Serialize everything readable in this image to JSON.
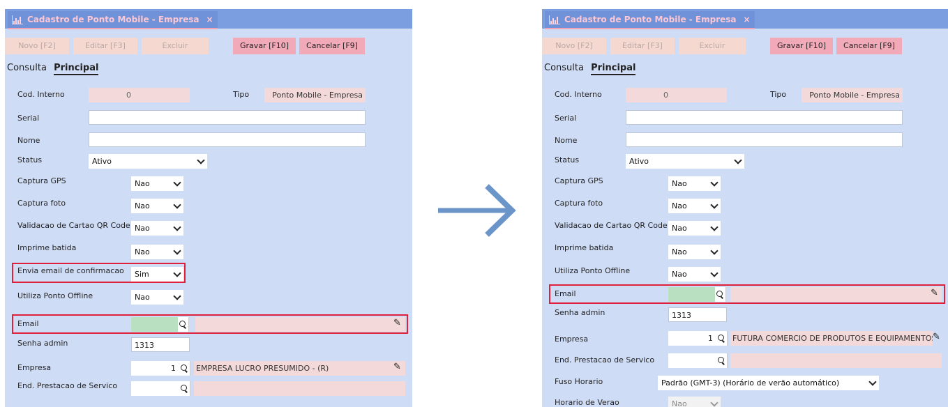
{
  "window": {
    "title": "Cadastro de Ponto Mobile - Empresa",
    "close": "×"
  },
  "toolbar": {
    "novo": "Novo [F2]",
    "editar": "Editar [F3]",
    "excluir": "Excluir",
    "gravar": "Gravar [F10]",
    "cancelar": "Cancelar [F9]"
  },
  "tabs": {
    "consulta": "Consulta",
    "principal": "Principal"
  },
  "labels": {
    "cod_interno": "Cod. Interno",
    "tipo": "Tipo",
    "serial": "Serial",
    "nome": "Nome",
    "status": "Status",
    "captura_gps": "Captura GPS",
    "captura_foto": "Captura foto",
    "validacao_qr": "Validacao de Cartao QR Code",
    "imprime_batida": "Imprime batida",
    "envia_email": "Envia email de confirmacao",
    "utiliza_offline": "Utiliza Ponto Offline",
    "email": "Email",
    "senha_admin": "Senha admin",
    "empresa": "Empresa",
    "end_prestacao": "End. Prestacao de Servico",
    "fuso_horario": "Fuso Horario",
    "horario_verao": "Horario de Verao"
  },
  "before": {
    "cod_interno": "0",
    "tipo": "Ponto Mobile - Empresa",
    "status": "Ativo",
    "captura_gps": "Nao",
    "captura_foto": "Nao",
    "validacao_qr": "Nao",
    "imprime_batida": "Nao",
    "envia_email": "Sim",
    "utiliza_offline": "Nao",
    "senha_admin": "1313",
    "empresa_code": "1",
    "empresa_name": "EMPRESA LUCRO PRESUMIDO - (R)"
  },
  "after": {
    "cod_interno": "0",
    "tipo": "Ponto Mobile - Empresa",
    "status": "Ativo",
    "captura_gps": "Nao",
    "captura_foto": "Nao",
    "validacao_qr": "Nao",
    "imprime_batida": "Nao",
    "utiliza_offline": "Nao",
    "senha_admin": "1313",
    "empresa_code": "1",
    "empresa_name": "FUTURA COMERCIO DE PRODUTOS E EQUIPAMENTOS E",
    "fuso_horario": "Padrão (GMT-3) (Horário de verão automático)",
    "horario_verao": "Nao"
  },
  "colors": {
    "panel": "#cfdcf6",
    "titlebar": "#7a9ee0",
    "highlight": "#e0203b",
    "arrow": "#6b95c9"
  },
  "icons": {
    "title": "bar-chart-icon",
    "lookup": "search-icon",
    "edit": "pencil-icon",
    "transition": "arrow-right-icon"
  }
}
